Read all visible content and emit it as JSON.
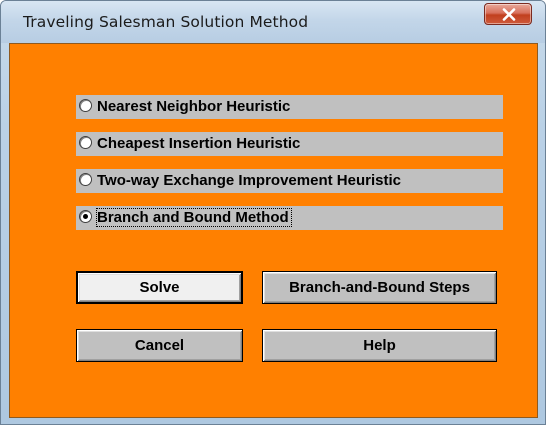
{
  "window": {
    "title": "Traveling Salesman Solution Method",
    "close_glyph": "X"
  },
  "options": [
    {
      "label": "Nearest Neighbor Heuristic",
      "selected": false
    },
    {
      "label": "Cheapest Insertion Heuristic",
      "selected": false
    },
    {
      "label": "Two-way Exchange Improvement Heuristic",
      "selected": false
    },
    {
      "label": "Branch and Bound Method",
      "selected": true
    }
  ],
  "buttons": {
    "solve": "Solve",
    "bb_steps": "Branch-and-Bound Steps",
    "cancel": "Cancel",
    "help": "Help"
  },
  "colors": {
    "client_background": "#ff8000",
    "option_background": "#c0c0c0",
    "titlebar": "#c3d6e9",
    "close_button": "#c1401f"
  },
  "icons": {
    "close": "close-x-icon",
    "radio_unselected": "radio-empty-icon",
    "radio_selected": "radio-filled-icon"
  }
}
